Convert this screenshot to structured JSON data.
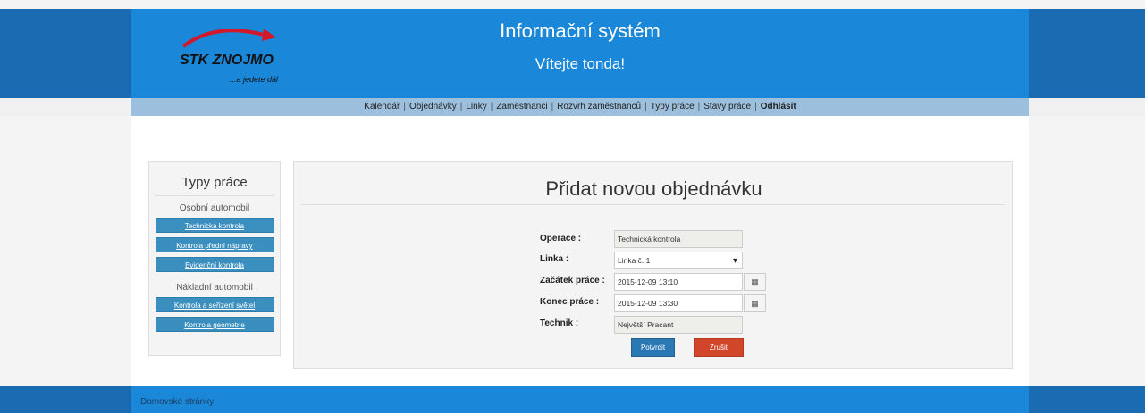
{
  "header": {
    "logo_text": "STK ZNOJMO",
    "logo_tagline": "...a jedete dál",
    "title": "Informační systém",
    "welcome": "Vítejte tonda!"
  },
  "nav": {
    "items": [
      "Kalendář",
      "Objednávky",
      "Linky",
      "Zaměstnanci",
      "Rozvrh zaměstnanců",
      "Typy práce",
      "Stavy práce"
    ],
    "logout": "Odhlásit",
    "separator": "|"
  },
  "sidebar": {
    "title": "Typy práce",
    "group1": {
      "label": "Osobní automobil",
      "buttons": [
        "Technická kontrola",
        "Kontrola přední nápravy",
        "Evidenční kontrola"
      ]
    },
    "group2": {
      "label": "Nákladní automobil",
      "buttons": [
        "Kontrola a seřízení světel",
        "Kontrola geometrie"
      ]
    }
  },
  "form": {
    "title": "Přidat novou objednávku",
    "operation_label": "Operace :",
    "operation_value": "Technická kontrola",
    "line_label": "Linka :",
    "line_value": "Linka č. 1",
    "start_label": "Začátek práce :",
    "start_value": "2015-12-09 13:10",
    "end_label": "Konec práce :",
    "end_value": "2015-12-09 13:30",
    "technician_label": "Technik :",
    "technician_value": "Největší Pracant",
    "confirm": "Potvrdit",
    "cancel": "Zrušit"
  },
  "footer": {
    "text": "Domovské stránky"
  },
  "icons": {
    "calendar": "calendar-icon",
    "dropdown": "chevron-down-icon"
  },
  "colors": {
    "header_blue": "#1a87d8",
    "nav_blue": "#9bbfdc",
    "sidebar_button": "#3a8fbe",
    "confirm": "#2a79b5",
    "cancel": "#d1462a"
  }
}
